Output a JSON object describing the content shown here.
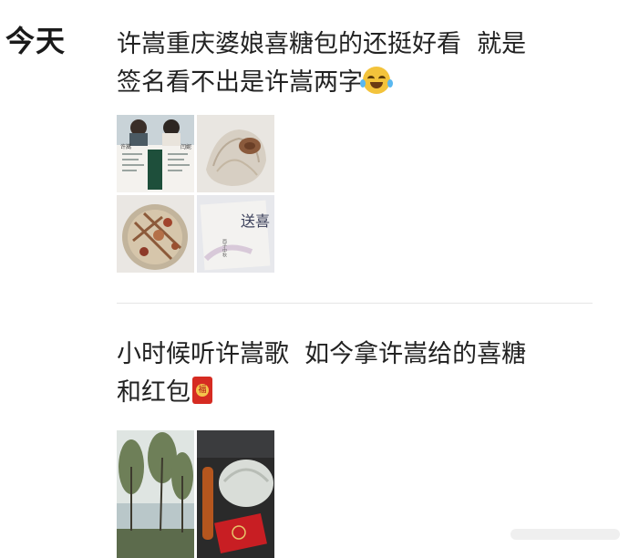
{
  "day_label": "今天",
  "posts": [
    {
      "line1": "许嵩重庆婆娘喜糖包的还挺好看  就是",
      "line2": "签名看不出是许嵩两字",
      "emoji": "laughing-tears-icon",
      "images": [
        {
          "name": "wedding-card-photo",
          "label_left": "许嵩",
          "label_right": "闫妮"
        },
        {
          "name": "candy-bag-photo"
        },
        {
          "name": "dried-flowers-bowl-photo"
        },
        {
          "name": "calligraphy-card-photo",
          "text": "送喜",
          "small_text": "西子中秋"
        }
      ]
    },
    {
      "line1": "小时候听许嵩歌  如今拿许嵩给的喜糖",
      "line2": "和红包",
      "emoji": "red-envelope-icon",
      "envelope_char": "福",
      "images": [
        {
          "name": "lake-trees-photo"
        },
        {
          "name": "red-packet-and-candy-photo"
        }
      ]
    }
  ],
  "colors": {
    "text": "#222222",
    "divider": "#e6e6e6",
    "envelope": "#d62b22"
  }
}
